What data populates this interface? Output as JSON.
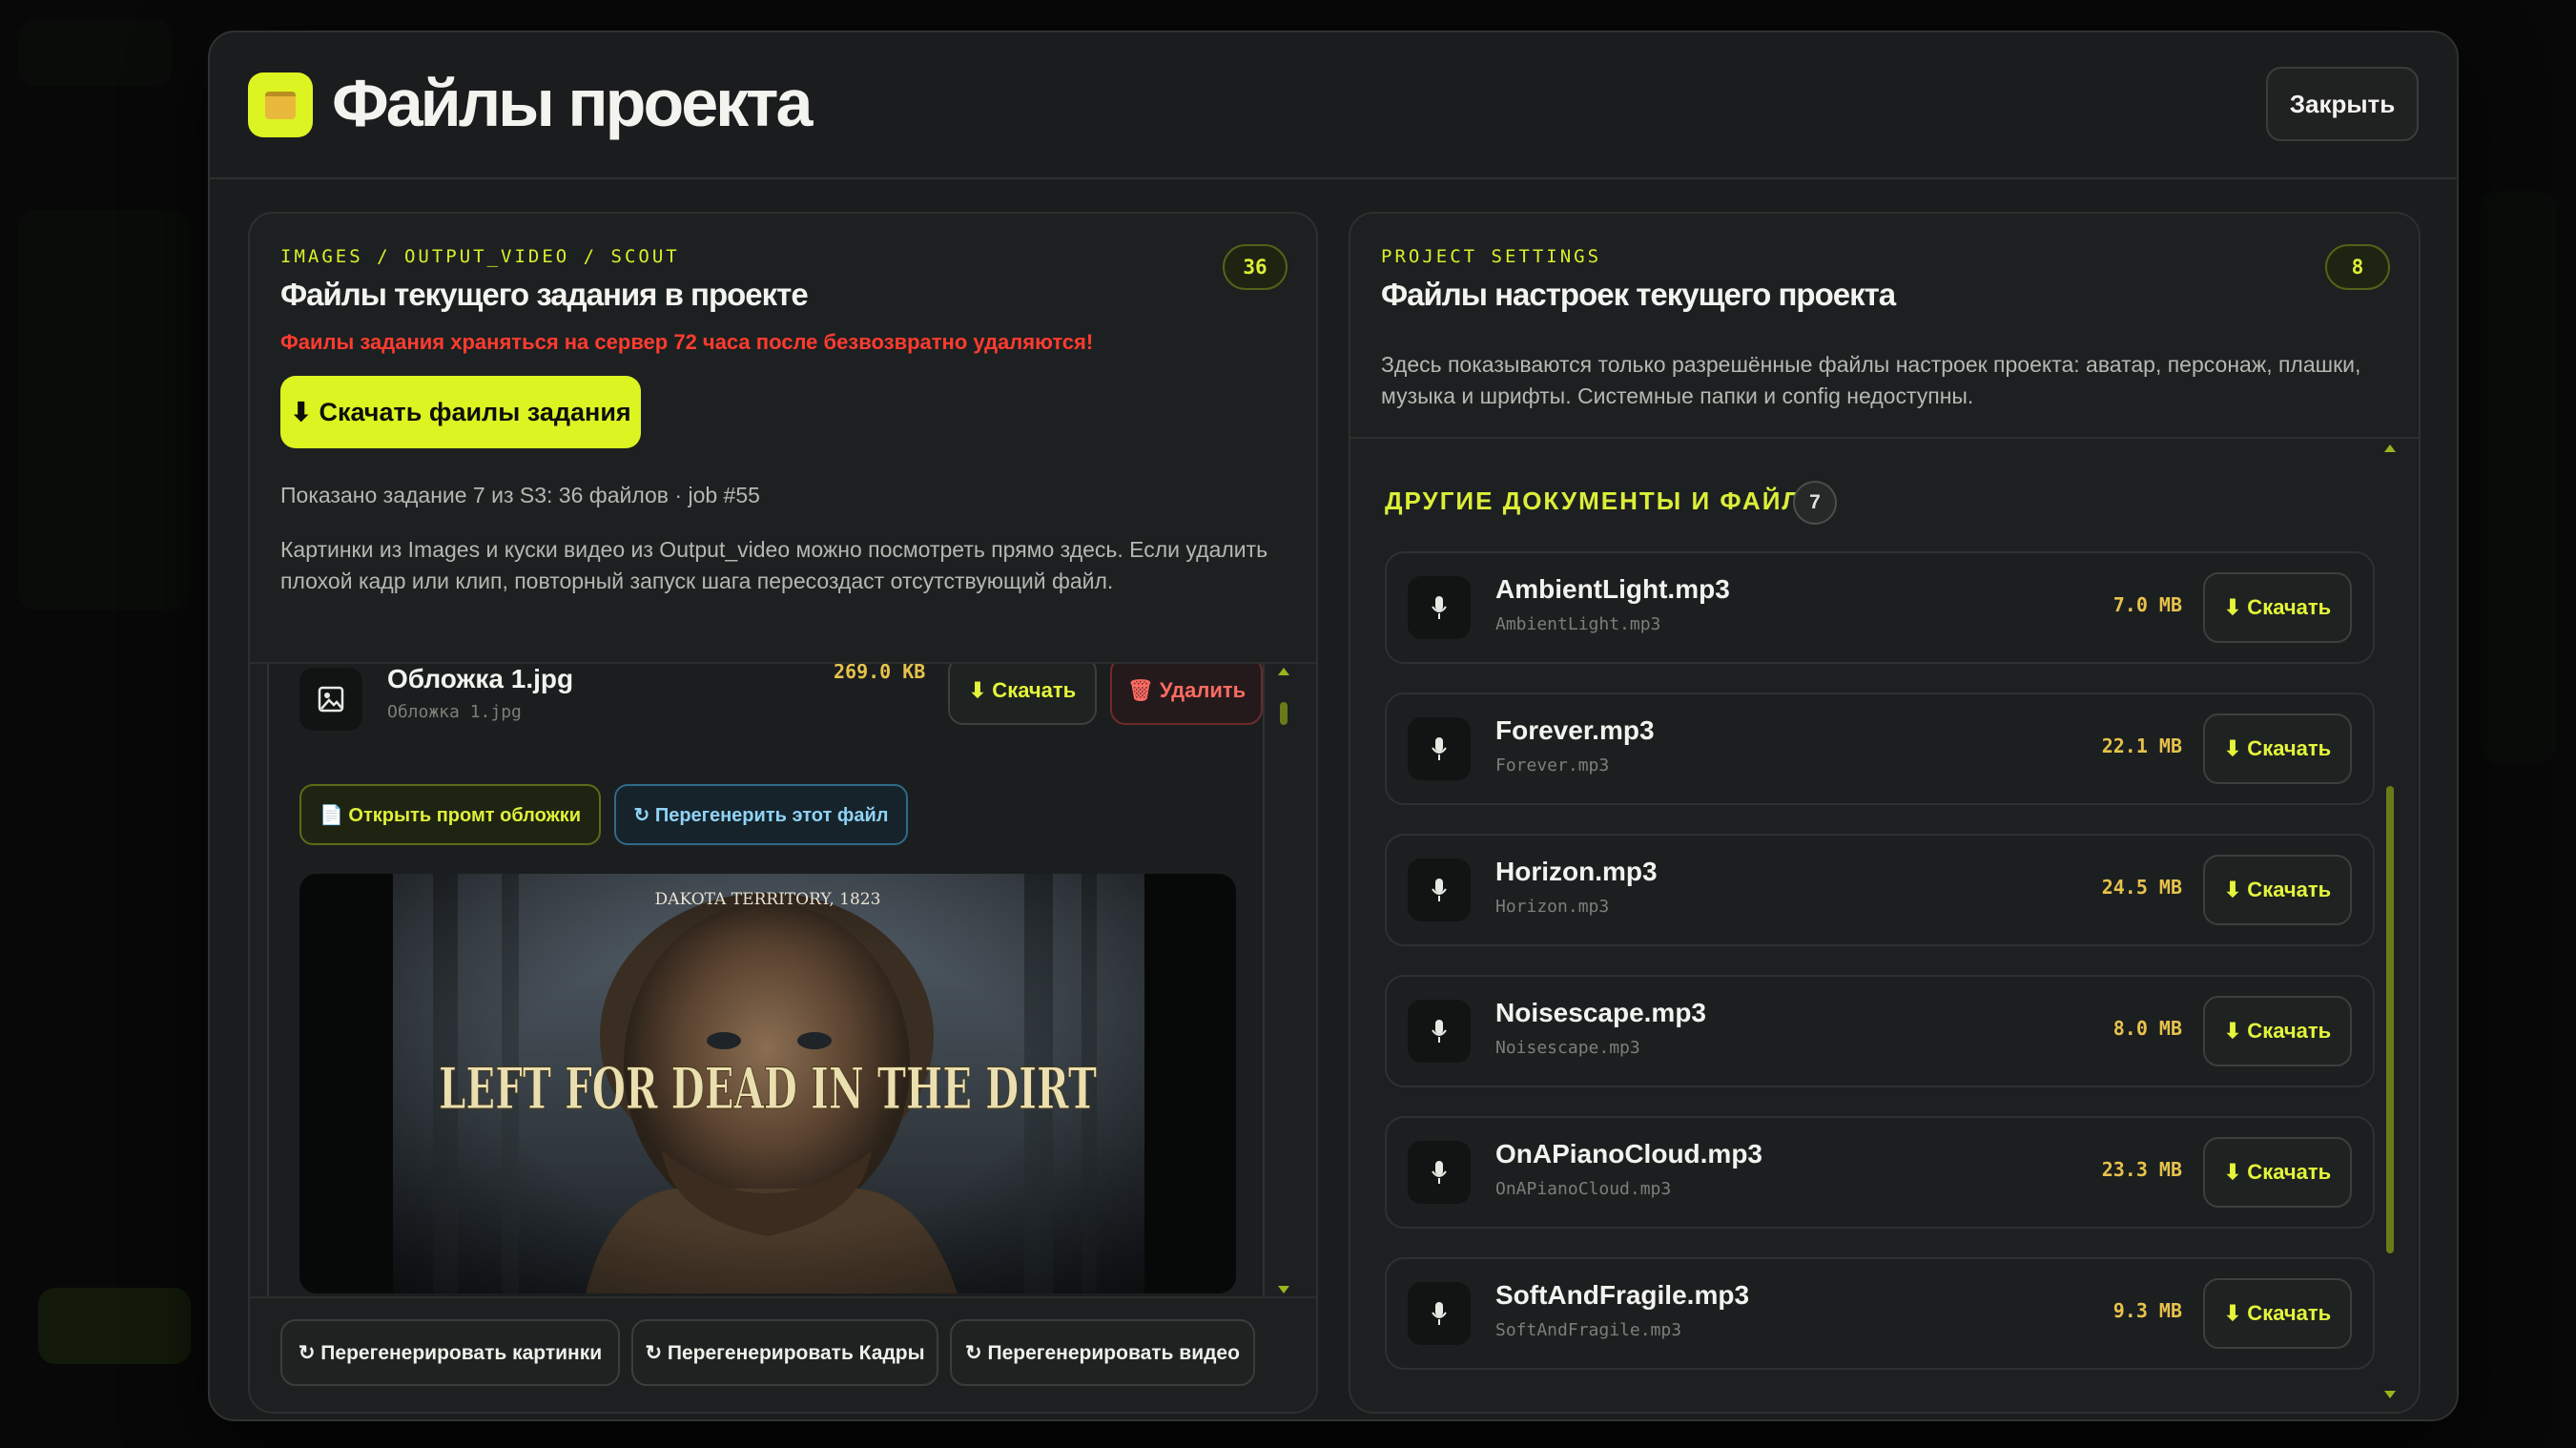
{
  "modal": {
    "title": "Файлы проекта",
    "close_label": "Закрыть"
  },
  "left_panel": {
    "kicker": "IMAGES / OUTPUT_VIDEO / SCOUT",
    "title": "Файлы текущего задания в проекте",
    "count": "36",
    "warning": "Фаилы задания храняться на сервер 72 часа после безвозвратно удаляются!",
    "download_all_label": "⬇ Скачать фаилы задания",
    "meta": "Показано задание 7 из S3: 36 файлов · job #55",
    "description_line1": "Картинки из Images и куски видео из Output_video можно посмотреть прямо здесь. Если удалить",
    "description_line2": "плохой кадр или клип, повторный запуск шага пересоздаст отсутствующий файл.",
    "file": {
      "name": "Обложка 1.jpg",
      "subname": "Обложка 1.jpg",
      "size": "269.0 KB",
      "icon": "image-icon",
      "download_label": "⬇ Скачать",
      "delete_label": "🗑 Удалить",
      "open_prompt_label": "📄 Открыть промт обложки",
      "regenerate_label": "↻ Перегенерить этот файл",
      "preview": {
        "caption_top": "DAKOTA TERRITORY, 1823",
        "headline": "LEFT FOR DEAD IN THE DIRT"
      }
    },
    "footer_buttons": [
      "↻ Перегенерировать картинки",
      "↻ Перегенерировать Кадры",
      "↻ Перегенерировать видео"
    ]
  },
  "right_panel": {
    "kicker": "PROJECT SETTINGS",
    "title": "Файлы настроек текущего проекта",
    "count": "8",
    "description_line1": "Здесь показываются только разрешённые файлы настроек проекта: аватар, персонаж, плашки,",
    "description_line2": "музыка и шрифты. Системные папки и config недоступны.",
    "section_title": "ДРУГИЕ ДОКУМЕНТЫ И ФАЙЛЫ",
    "section_count": "7",
    "download_label": "⬇ Скачать",
    "files": [
      {
        "name": "AmbientLight.mp3",
        "sub": "AmbientLight.mp3",
        "size": "7.0 MB"
      },
      {
        "name": "Forever.mp3",
        "sub": "Forever.mp3",
        "size": "22.1 MB"
      },
      {
        "name": "Horizon.mp3",
        "sub": "Horizon.mp3",
        "size": "24.5 MB"
      },
      {
        "name": "Noisescape.mp3",
        "sub": "Noisescape.mp3",
        "size": "8.0 MB"
      },
      {
        "name": "OnAPianoCloud.mp3",
        "sub": "OnAPianoCloud.mp3",
        "size": "23.3 MB"
      },
      {
        "name": "SoftAndFragile.mp3",
        "sub": "SoftAndFragile.mp3",
        "size": "9.3 MB"
      }
    ],
    "file_icon": "microphone-icon"
  },
  "colors": {
    "accent": "#dcf422",
    "warning": "#ff3b2f",
    "size_text": "#e7c24b",
    "danger": "#ff6a62",
    "info": "#8fd3f6"
  }
}
